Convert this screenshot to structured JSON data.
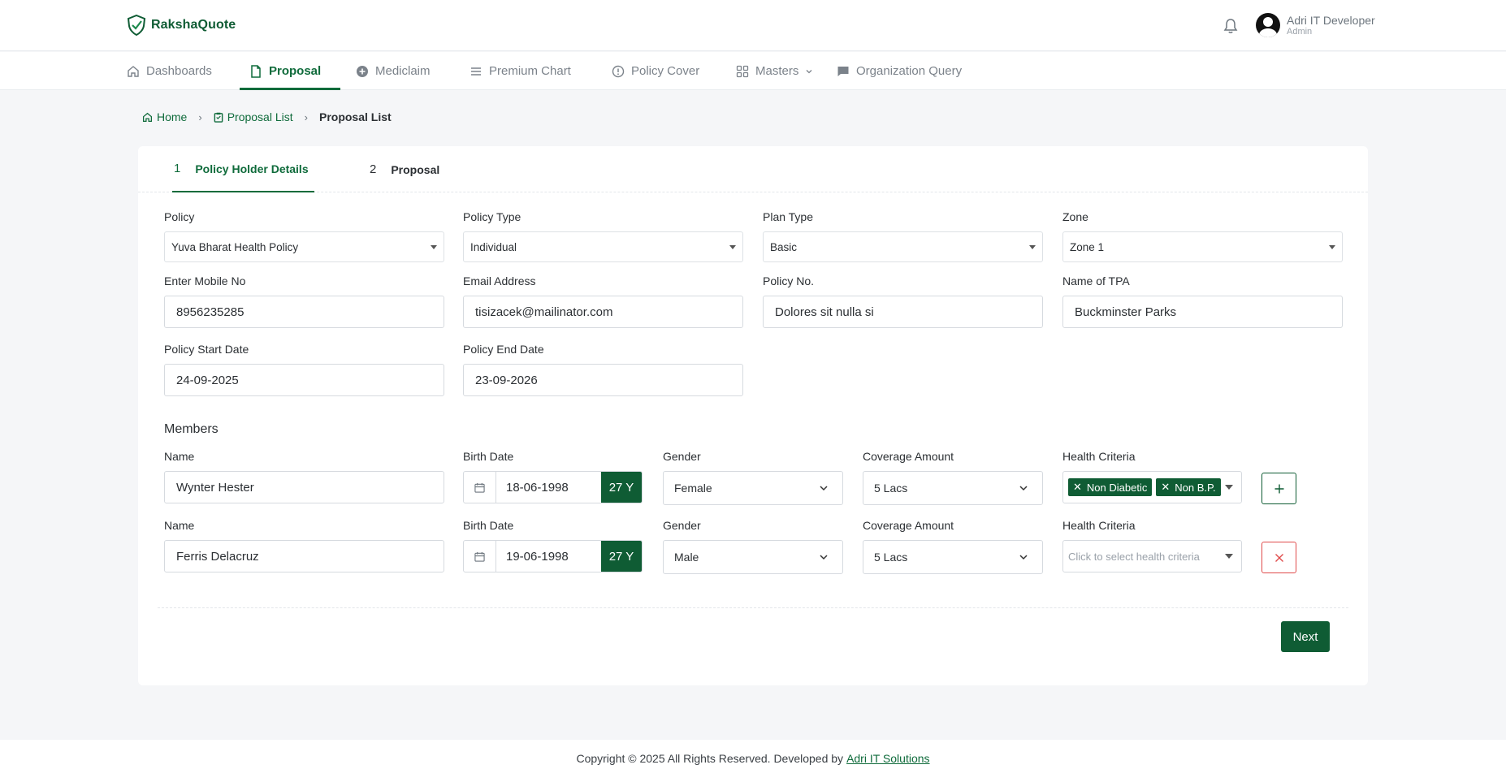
{
  "brand": {
    "name": "RakshaQuote"
  },
  "user": {
    "name": "Adri IT Developer",
    "role": "Admin"
  },
  "nav": {
    "items": [
      {
        "label": "Dashboards",
        "icon": "home-icon"
      },
      {
        "label": "Proposal",
        "icon": "document-icon",
        "active": true
      },
      {
        "label": "Mediclaim",
        "icon": "plus-circle-icon"
      },
      {
        "label": "Premium Chart",
        "icon": "list-icon"
      },
      {
        "label": "Policy Cover",
        "icon": "info-circle-icon"
      },
      {
        "label": "Masters",
        "icon": "grid-icon"
      },
      {
        "label": "Organization Query",
        "icon": "chat-icon"
      }
    ]
  },
  "breadcrumb": {
    "home": "Home",
    "list": "Proposal List",
    "current": "Proposal List"
  },
  "steps": [
    {
      "num": "1",
      "label": "Policy Holder Details"
    },
    {
      "num": "2",
      "label": "Proposal"
    }
  ],
  "form": {
    "policy": {
      "label": "Policy",
      "value": "Yuva Bharat Health Policy"
    },
    "policy_type": {
      "label": "Policy Type",
      "value": "Individual"
    },
    "plan_type": {
      "label": "Plan Type",
      "value": "Basic"
    },
    "zone": {
      "label": "Zone",
      "value": "Zone 1"
    },
    "mobile": {
      "label": "Enter Mobile No",
      "value": "8956235285"
    },
    "email": {
      "label": "Email Address",
      "value": "tisizacek@mailinator.com"
    },
    "policy_no": {
      "label": "Policy No.",
      "value": "Dolores sit nulla si"
    },
    "tpa": {
      "label": "Name of TPA",
      "value": "Buckminster Parks"
    },
    "start_date": {
      "label": "Policy Start Date",
      "value": "24-09-2025"
    },
    "end_date": {
      "label": "Policy End Date",
      "value": "23-09-2026"
    }
  },
  "members": {
    "title": "Members",
    "labels": {
      "name": "Name",
      "birth": "Birth Date",
      "gender": "Gender",
      "coverage": "Coverage Amount",
      "health": "Health Criteria"
    },
    "rows": [
      {
        "name": "Wynter Hester",
        "birth": "18-06-1998",
        "age": "27 Y",
        "gender": "Female",
        "coverage": "5 Lacs",
        "tags": [
          "Non Diabetic",
          "Non B.P."
        ]
      },
      {
        "name": "Ferris Delacruz",
        "birth": "19-06-1998",
        "age": "27 Y",
        "gender": "Male",
        "coverage": "5 Lacs",
        "health_placeholder": "Click to select health criteria"
      }
    ]
  },
  "actions": {
    "next": "Next"
  },
  "footer": {
    "text": "Copyright © 2025 All Rights Reserved. Developed by",
    "link": "Adri IT Solutions"
  },
  "colors": {
    "primary": "#0f5c34",
    "danger": "#e04b4b"
  }
}
